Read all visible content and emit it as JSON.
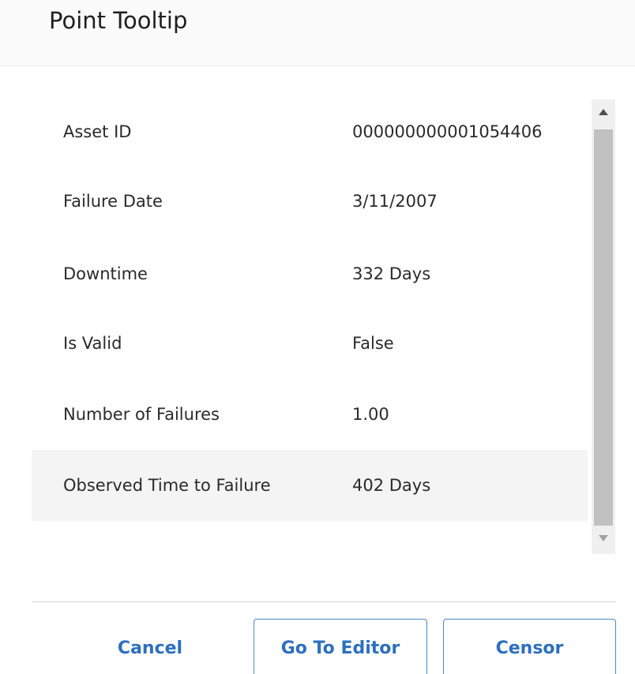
{
  "dialog": {
    "title": "Point Tooltip"
  },
  "rows": [
    {
      "label": "Asset ID",
      "value": "000000000001054406"
    },
    {
      "label": "Failure Date",
      "value": "3/11/2007"
    },
    {
      "label": "Downtime",
      "value": "332 Days"
    },
    {
      "label": "Is Valid",
      "value": "False"
    },
    {
      "label": "Number of Failures",
      "value": "1.00"
    },
    {
      "label": "Observed Time to Failure",
      "value": "402 Days"
    }
  ],
  "footer": {
    "cancel_label": "Cancel",
    "go_to_editor_label": "Go To Editor",
    "censor_label": "Censor"
  },
  "colors": {
    "accent": "#2d6fbf",
    "highlight_row": "#f4f4f4"
  }
}
